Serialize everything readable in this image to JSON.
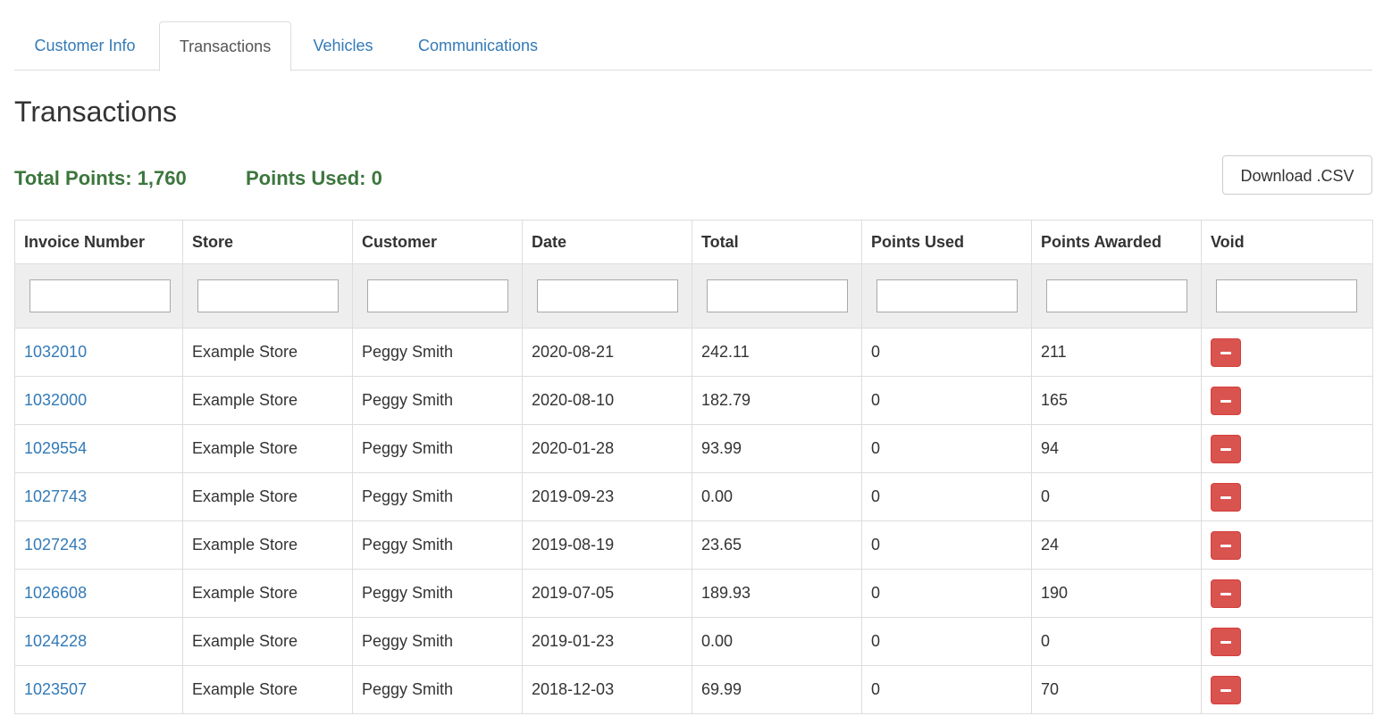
{
  "tabs": [
    {
      "label": "Customer Info",
      "active": false
    },
    {
      "label": "Transactions",
      "active": true
    },
    {
      "label": "Vehicles",
      "active": false
    },
    {
      "label": "Communications",
      "active": false
    }
  ],
  "page_title": "Transactions",
  "summary": {
    "total_points": "Total Points: 1,760",
    "points_used": "Points Used: 0"
  },
  "download_button": "Download .CSV",
  "table": {
    "columns": [
      "Invoice Number",
      "Store",
      "Customer",
      "Date",
      "Total",
      "Points Used",
      "Points Awarded",
      "Void"
    ],
    "rows": [
      {
        "invoice": "1032010",
        "store": "Example Store",
        "customer": "Peggy Smith",
        "date": "2020-08-21",
        "total": "242.11",
        "points_used": "0",
        "points_awarded": "211"
      },
      {
        "invoice": "1032000",
        "store": "Example Store",
        "customer": "Peggy Smith",
        "date": "2020-08-10",
        "total": "182.79",
        "points_used": "0",
        "points_awarded": "165"
      },
      {
        "invoice": "1029554",
        "store": "Example Store",
        "customer": "Peggy Smith",
        "date": "2020-01-28",
        "total": "93.99",
        "points_used": "0",
        "points_awarded": "94"
      },
      {
        "invoice": "1027743",
        "store": "Example Store",
        "customer": "Peggy Smith",
        "date": "2019-09-23",
        "total": "0.00",
        "points_used": "0",
        "points_awarded": "0"
      },
      {
        "invoice": "1027243",
        "store": "Example Store",
        "customer": "Peggy Smith",
        "date": "2019-08-19",
        "total": "23.65",
        "points_used": "0",
        "points_awarded": "24"
      },
      {
        "invoice": "1026608",
        "store": "Example Store",
        "customer": "Peggy Smith",
        "date": "2019-07-05",
        "total": "189.93",
        "points_used": "0",
        "points_awarded": "190"
      },
      {
        "invoice": "1024228",
        "store": "Example Store",
        "customer": "Peggy Smith",
        "date": "2019-01-23",
        "total": "0.00",
        "points_used": "0",
        "points_awarded": "0"
      },
      {
        "invoice": "1023507",
        "store": "Example Store",
        "customer": "Peggy Smith",
        "date": "2018-12-03",
        "total": "69.99",
        "points_used": "0",
        "points_awarded": "70"
      }
    ]
  },
  "colors": {
    "link": "#337ab7",
    "points_text": "#3c763d",
    "void_button": "#d9534f",
    "filter_row_bg": "#eeeeee"
  },
  "icons": {
    "void": "minus-icon"
  }
}
